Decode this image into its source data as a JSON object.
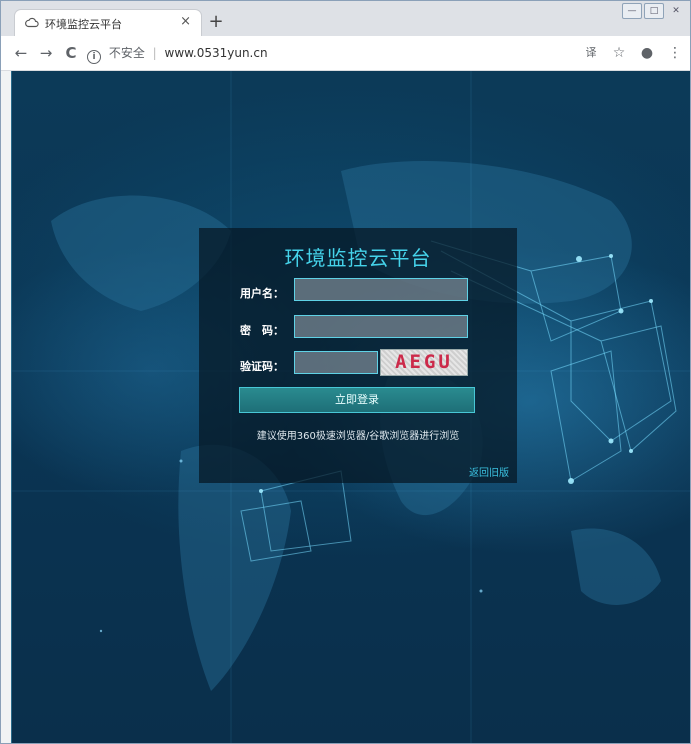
{
  "browser": {
    "tab_title": "环境监控云平台",
    "tab_close": "×",
    "new_tab": "+",
    "back": "←",
    "forward": "→",
    "reload": "C",
    "info_glyph": "i",
    "security_text": "不安全",
    "url_separator": "|",
    "url": "www.0531yun.cn",
    "menu_glyph": "⋮",
    "translate_glyph": "译",
    "star_glyph": "☆",
    "account_glyph": "●",
    "win_min": "—",
    "win_max": "□",
    "win_close": "✕"
  },
  "login": {
    "title": "环境监控云平台",
    "username_label": "用户名：",
    "password_label": "密　码：",
    "captcha_label": "验证码：",
    "username_value": "",
    "password_value": "",
    "captcha_value": "",
    "captcha_text": "AEGU",
    "submit_label": "立即登录",
    "tip": "建议使用360极速浏览器/谷歌浏览器进行浏览",
    "back_link": "返回旧版"
  },
  "colors": {
    "accent": "#45d3ea",
    "background": "#0a3554",
    "captcha_text": "#cc2a4a"
  }
}
